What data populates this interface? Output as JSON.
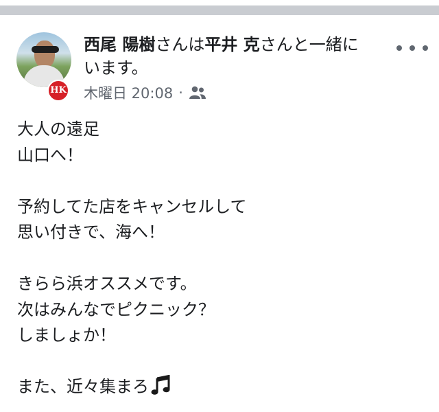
{
  "post": {
    "author": "西尾 陽樹",
    "san1": "さんは",
    "tagged": "平井 克",
    "san2": "さんと一緒に",
    "line2": "います。",
    "timestamp": "木曜日 20:08",
    "separator": "·",
    "audience_icon": "friends-icon",
    "avatar_badge": "HK",
    "more_icon": "more-options-icon",
    "body_lines": [
      "大人の遠足",
      "山口へ！",
      "",
      "予約してた店をキャンセルして",
      "思い付きで、海へ！",
      "",
      "きらら浜オススメです。",
      "次はみんなでピクニック？",
      "しましょか！",
      "",
      "また、近々集まろ"
    ],
    "trailing_icon": "music-note-icon"
  },
  "colors": {
    "divider": "#c9ccd1",
    "text": "#1c1e21",
    "meta": "#616770",
    "badge": "#d62027"
  }
}
